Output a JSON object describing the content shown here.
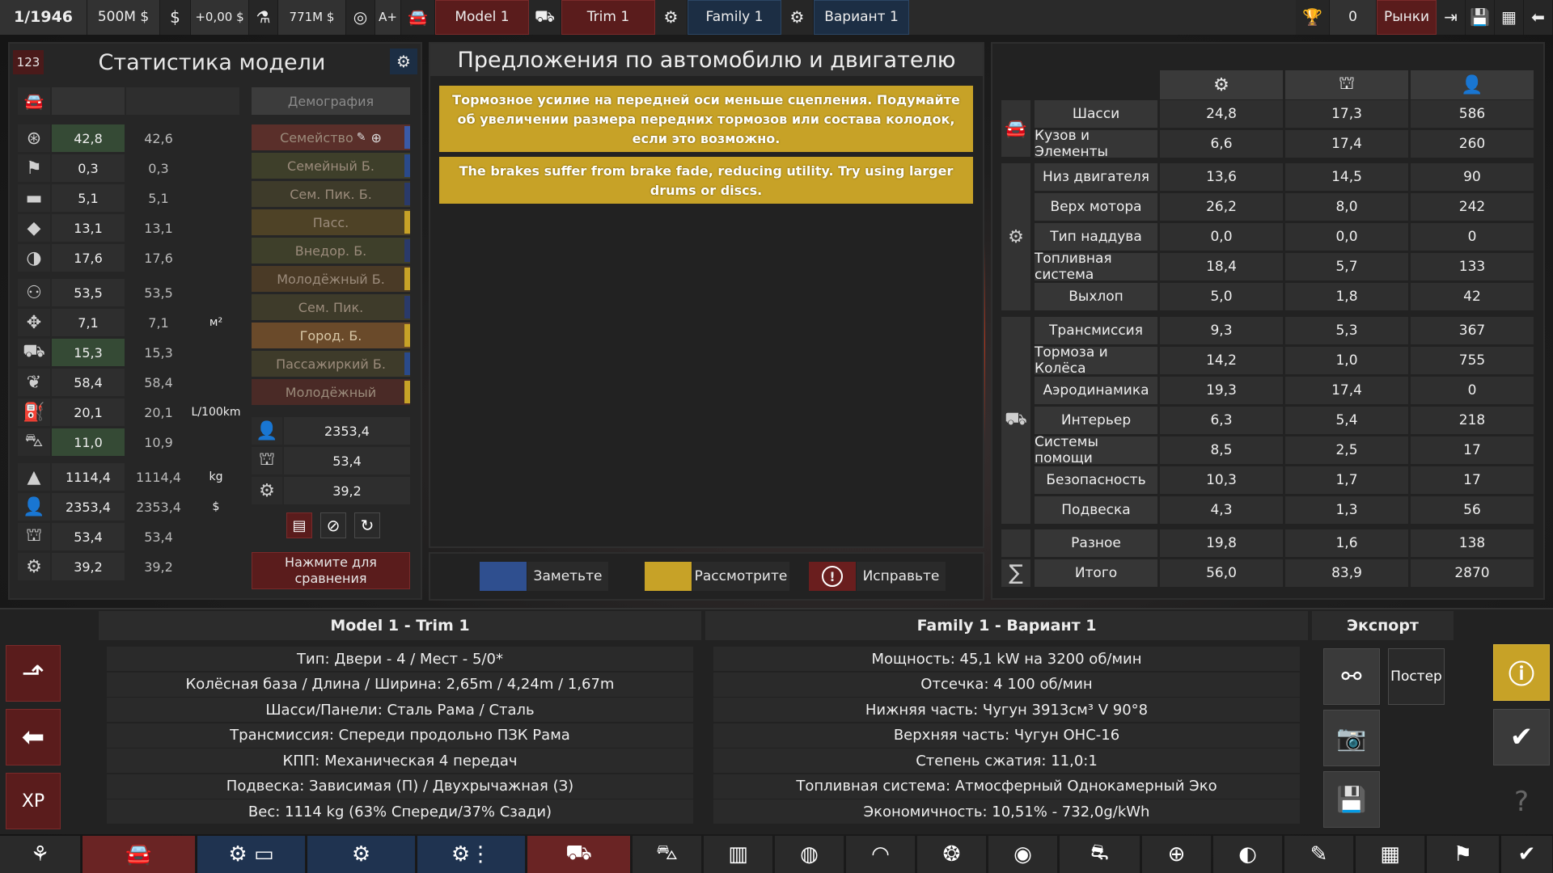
{
  "top": {
    "date": "1/1946",
    "money": "500M $",
    "change": "+0,00 $",
    "cost": "771M $",
    "rating": "A+",
    "model": "Model 1",
    "trim": "Trim 1",
    "family": "Family 1",
    "variant": "Вариант 1",
    "trophy_count": "0",
    "markets": "Рынки"
  },
  "stats": {
    "badge": "123",
    "title": "Статистика модели",
    "demography": "Демография",
    "rows": [
      {
        "icon": "steering-icon",
        "v1": "42,8",
        "v2": "42,6",
        "unit": "",
        "hl": true
      },
      {
        "icon": "flag-icon",
        "v1": "0,3",
        "v2": "0,3",
        "unit": "",
        "hl": false
      },
      {
        "icon": "seat-icon",
        "v1": "5,1",
        "v2": "5,1",
        "unit": "",
        "hl": false
      },
      {
        "icon": "gem-icon",
        "v1": "13,1",
        "v2": "13,1",
        "unit": "",
        "hl": false
      },
      {
        "icon": "safety-icon",
        "v1": "17,6",
        "v2": "17,6",
        "unit": "",
        "hl": false
      },
      {
        "icon": "passengers-icon",
        "v1": "53,5",
        "v2": "53,5",
        "unit": "",
        "hl": false
      },
      {
        "icon": "cargo-icon",
        "v1": "7,1",
        "v2": "7,1",
        "unit": "м²",
        "hl": false
      },
      {
        "icon": "offroad-icon",
        "v1": "15,3",
        "v2": "15,3",
        "unit": "",
        "hl": true
      },
      {
        "icon": "environment-icon",
        "v1": "58,4",
        "v2": "58,4",
        "unit": "",
        "hl": false
      },
      {
        "icon": "fuel-icon",
        "v1": "20,1",
        "v2": "20,1",
        "unit": "L/100km",
        "hl": false
      },
      {
        "icon": "towing-icon",
        "v1": "11,0",
        "v2": "10,9",
        "unit": "",
        "hl": true
      },
      {
        "icon": "weight-icon",
        "v1": "1114,4",
        "v2": "1114,4",
        "unit": "kg",
        "hl": false
      },
      {
        "icon": "cost-icon",
        "v1": "2353,4",
        "v2": "2353,4",
        "unit": "$",
        "hl": false
      },
      {
        "icon": "production-icon",
        "v1": "53,4",
        "v2": "53,4",
        "unit": "",
        "hl": false
      },
      {
        "icon": "engineering-icon",
        "v1": "39,2",
        "v2": "39,2",
        "unit": "",
        "hl": false
      }
    ],
    "demos": [
      {
        "label": "Семейство",
        "color": "#5a2f2a",
        "bar": "#3a5aa8"
      },
      {
        "label": "Семейный Б.",
        "color": "#3e3f2a",
        "bar": "#2a4a8a"
      },
      {
        "label": "Сем. Пик. Б.",
        "color": "#3e3b2a",
        "bar": "#2a3a6a"
      },
      {
        "label": "Пасс.",
        "color": "#4e4226",
        "bar": "#c7a227"
      },
      {
        "label": "Внедор. Б.",
        "color": "#3e3f2a",
        "bar": "#2a3a6a"
      },
      {
        "label": "Молодёжный Б.",
        "color": "#4a3a26",
        "bar": "#c7a227"
      },
      {
        "label": "Сем. Пик.",
        "color": "#3e3b2a",
        "bar": "#2a3a6a"
      },
      {
        "label": "Город. Б.",
        "color": "#6a4a2a",
        "bar": "#c7a227"
      },
      {
        "label": "Пассажиркий Б.",
        "color": "#3e3b2a",
        "bar": "#2a4a8a"
      },
      {
        "label": "Молодёжный",
        "color": "#4a2a26",
        "bar": "#c7a227"
      }
    ],
    "cost": "2353,4",
    "prod": "53,4",
    "eng": "39,2",
    "compare": "Нажмите для сравнения"
  },
  "suggestions": {
    "title": "Предложения по автомобилю и двигателю",
    "items": [
      "Тормозное усилие на передней оси меньше сцепления. Подумайте об увеличении размера передних тормозов или состава колодок, если это возможно.",
      "The brakes suffer from brake fade, reducing utility. Try using larger drums or discs."
    ],
    "legend": [
      "Заметьте",
      "Рассмотрите",
      "Исправьте"
    ],
    "legend_colors": [
      "#2f4f8f",
      "#c7a227",
      "#6a1e1e"
    ]
  },
  "breakdown": {
    "rows": [
      {
        "label": "Шасси",
        "a": "24,8",
        "b": "17,3",
        "c": "586"
      },
      {
        "label": "Кузов и Элементы",
        "a": "6,6",
        "b": "17,4",
        "c": "260"
      },
      {
        "label": "Низ двигателя",
        "a": "13,6",
        "b": "14,5",
        "c": "90"
      },
      {
        "label": "Верх мотора",
        "a": "26,2",
        "b": "8,0",
        "c": "242"
      },
      {
        "label": "Тип наддува",
        "a": "0,0",
        "b": "0,0",
        "c": "0"
      },
      {
        "label": "Топливная система",
        "a": "18,4",
        "b": "5,7",
        "c": "133"
      },
      {
        "label": "Выхлоп",
        "a": "5,0",
        "b": "1,8",
        "c": "42"
      },
      {
        "label": "Трансмиссия",
        "a": "9,3",
        "b": "5,3",
        "c": "367"
      },
      {
        "label": "Тормоза и Колёса",
        "a": "14,2",
        "b": "1,0",
        "c": "755"
      },
      {
        "label": "Аэродинамика",
        "a": "19,3",
        "b": "17,4",
        "c": "0"
      },
      {
        "label": "Интерьер",
        "a": "6,3",
        "b": "5,4",
        "c": "218"
      },
      {
        "label": "Системы помощи",
        "a": "8,5",
        "b": "2,5",
        "c": "17"
      },
      {
        "label": "Безопасность",
        "a": "10,3",
        "b": "1,7",
        "c": "17"
      },
      {
        "label": "Подвеска",
        "a": "4,3",
        "b": "1,3",
        "c": "56"
      },
      {
        "label": "Разное",
        "a": "19,8",
        "b": "1,6",
        "c": "138"
      },
      {
        "label": "Итого",
        "a": "56,0",
        "b": "83,9",
        "c": "2870"
      }
    ]
  },
  "summary": {
    "model_title": "Model 1 - Trim 1",
    "family_title": "Family 1 - Вариант 1",
    "export": "Экспорт",
    "poster": "Постер",
    "model_lines": [
      "Тип: Двери - 4 / Мест - 5/0*",
      "Колёсная база / Длина / Ширина: 2,65m / 4,24m / 1,67m",
      "Шасси/Панели: Сталь Рама / Сталь",
      "Трансмиссия: Спереди продольно ПЗК Рама",
      "КПП: Механическая 4 передач",
      "Подвеска: Зависимая (П) / Двухрычажная (З)",
      "Вес: 1114 kg (63% Спереди/37% Сзади)"
    ],
    "family_lines": [
      "Мощность: 45,1 kW на 3200 об/мин",
      "Отсечка:  4 100 об/мин",
      "Нижняя часть: Чугун 3913см³ V 90°8",
      "Верхняя часть: Чугун OHC-16",
      "Степень сжатия: 11,0:1",
      "Топливная система: Атмосферный Однокамерный Эко",
      "Экономичность: 10,51% - 732,0g/kWh"
    ]
  }
}
